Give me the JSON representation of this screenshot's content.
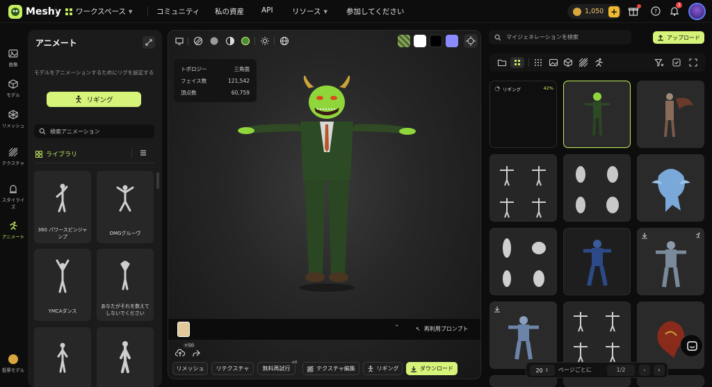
{
  "brand": {
    "name": "Meshy"
  },
  "nav": {
    "workspace": "ワークスペース",
    "community": "コミュニティ",
    "assets": "私の資産",
    "api": "API",
    "resources": "リソース",
    "join": "参加してください"
  },
  "header": {
    "credits": "1,050",
    "notification_count": "3"
  },
  "rail": [
    {
      "label": "画像"
    },
    {
      "label": "モデル"
    },
    {
      "label": "リメッシュ"
    },
    {
      "label": "テクスチャ"
    },
    {
      "label": "スタイライズ"
    },
    {
      "label": "アニメート"
    }
  ],
  "rail_bottom": {
    "label": "投票モデル"
  },
  "animate_panel": {
    "title": "アニメート",
    "description": "モデルをアニメーションするためにリグを設定する",
    "rig_button": "リギング",
    "search_placeholder": "検索アニメーション",
    "library_label": "ライブラリ",
    "animations": [
      {
        "name": "360 パワースピンジャンプ"
      },
      {
        "name": "OMGグルーヴ"
      },
      {
        "name": "YMCAダンス"
      },
      {
        "name": "あなたがそれを数えてしないでください"
      },
      {
        "name": ""
      },
      {
        "name": ""
      }
    ]
  },
  "viewport": {
    "stats": {
      "topology_label": "トポロジー",
      "topology_value": "三角面",
      "faces_label": "フェイス数",
      "faces_value": "121,542",
      "vertices_label": "頂点数",
      "vertices_value": "60,759"
    },
    "swatch_colors": [
      "#ffffff",
      "#000000",
      "#8b8bff"
    ],
    "reuse_prompt": "再利用プロンプト",
    "credit_cost": "+50",
    "multiplier": "x4",
    "actions": {
      "remesh": "リメッシュ",
      "retexture": "リテクスチャ",
      "free_trial": "無料再試行",
      "texture_edit": "テクスチャ編集",
      "rigging": "リギング",
      "download": "ダウンロード"
    }
  },
  "gallery": {
    "search_placeholder": "マイジェネレーションを検索",
    "upload_label": "アップロード",
    "rigging_status": "リギング",
    "rigging_percent": "42%",
    "pager": {
      "page_size": "20",
      "per_page_label": "ページごとに",
      "page": "1/2"
    }
  }
}
